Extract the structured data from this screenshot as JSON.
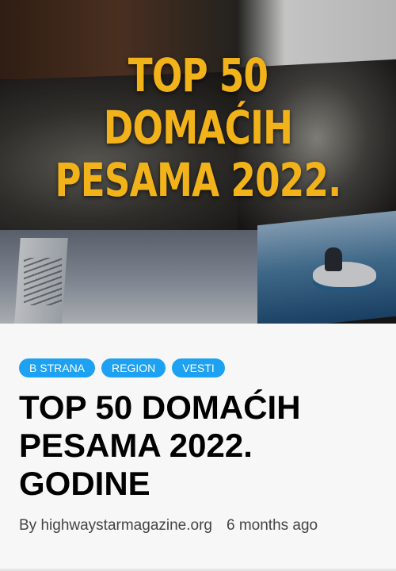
{
  "hero": {
    "title_line1": "TOP 50 DOMAĆIH",
    "title_line2": "PESAMA 2022.",
    "accent_color": "#f2b21a"
  },
  "tags": [
    {
      "label": "B STRANA"
    },
    {
      "label": "REGION"
    },
    {
      "label": "VESTI"
    }
  ],
  "tag_color": "#1da1f2",
  "article": {
    "title": "TOP 50 DOMAĆIH PESAMA 2022. GODINE",
    "author_prefix": "By",
    "author": "highwaystarmagazine.org",
    "time": "6 months ago"
  }
}
